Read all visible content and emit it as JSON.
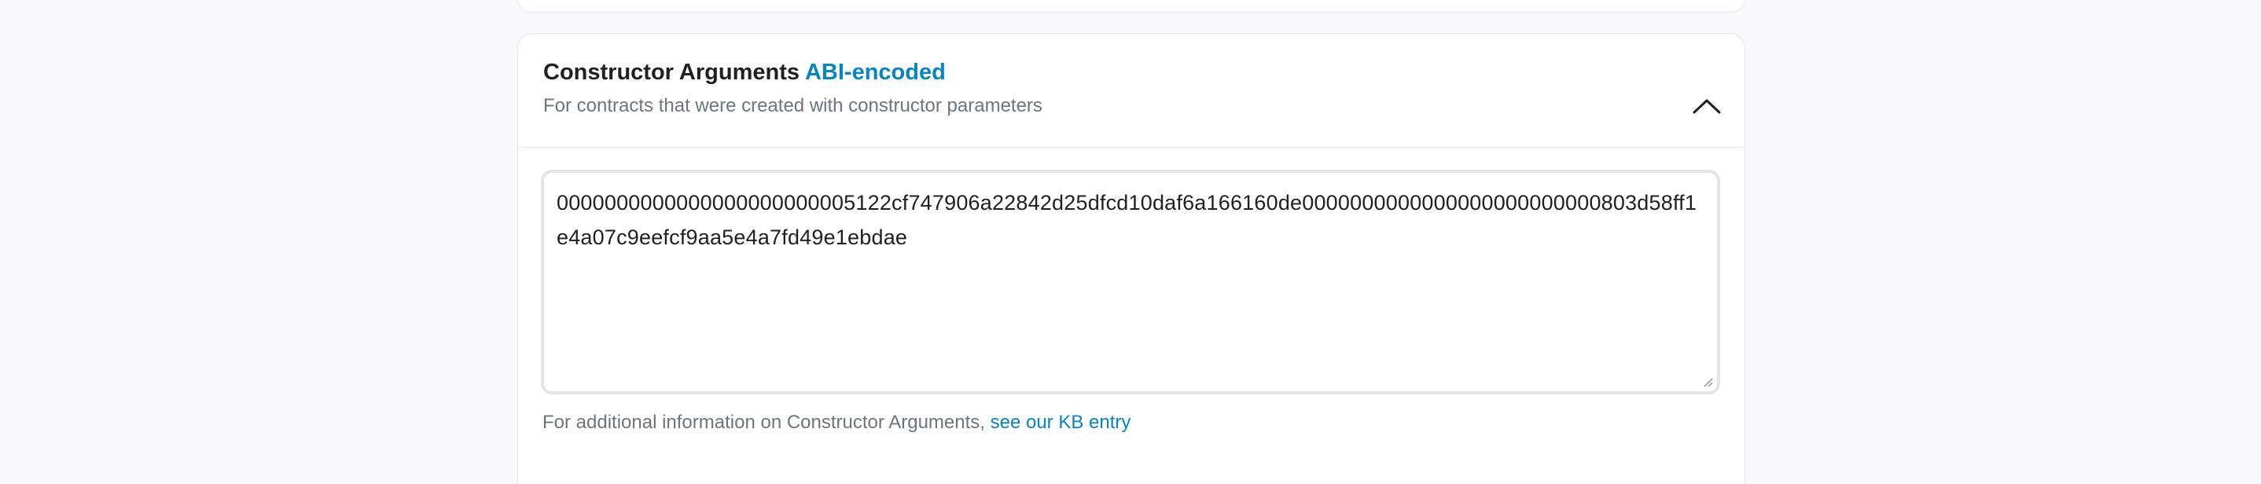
{
  "section": {
    "title": "Constructor Arguments",
    "title_accent": "ABI-encoded",
    "subtitle": "For contracts that were created with constructor parameters",
    "collapse_icon": "chevron-up-icon"
  },
  "constructor_args": {
    "value": "0000000000000000000000005122cf747906a22842d25dfcd10daf6a166160de0000000000000000000000000803d58ff1e4a07c9eefcf9aa5e4a7fd49e1ebdae"
  },
  "footer": {
    "text": "For additional information on Constructor Arguments,",
    "link_text": "see our KB entry"
  },
  "colors": {
    "accent": "#0784c3",
    "text": "#1e2024",
    "muted": "#6c757e",
    "border": "#e6e7ec",
    "background": "#f8f8fb"
  }
}
